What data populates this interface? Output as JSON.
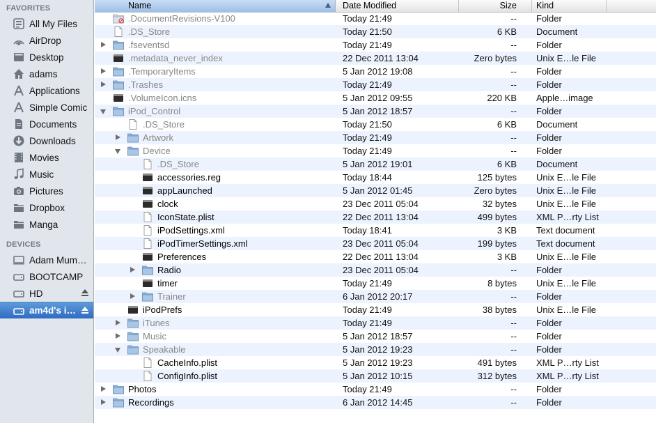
{
  "sidebar": {
    "favorites_header": "FAVORITES",
    "devices_header": "DEVICES",
    "favorites": [
      {
        "label": "All My Files",
        "icon": "all-files-icon"
      },
      {
        "label": "AirDrop",
        "icon": "airdrop-icon"
      },
      {
        "label": "Desktop",
        "icon": "desktop-icon"
      },
      {
        "label": "adams",
        "icon": "home-icon"
      },
      {
        "label": "Applications",
        "icon": "applications-icon"
      },
      {
        "label": "Simple Comic",
        "icon": "applications-icon"
      },
      {
        "label": "Documents",
        "icon": "documents-icon"
      },
      {
        "label": "Downloads",
        "icon": "downloads-icon"
      },
      {
        "label": "Movies",
        "icon": "movies-icon"
      },
      {
        "label": "Music",
        "icon": "music-icon"
      },
      {
        "label": "Pictures",
        "icon": "pictures-icon"
      },
      {
        "label": "Dropbox",
        "icon": "folder-icon"
      },
      {
        "label": "Manga",
        "icon": "folder-icon"
      }
    ],
    "devices": [
      {
        "label": "Adam Mum…",
        "icon": "computer-icon",
        "eject": false,
        "selected": false
      },
      {
        "label": "BOOTCAMP",
        "icon": "drive-icon",
        "eject": false,
        "selected": false
      },
      {
        "label": "HD",
        "icon": "drive-icon",
        "eject": true,
        "selected": false
      },
      {
        "label": "am4d's i…",
        "icon": "ipod-drive-icon",
        "eject": true,
        "selected": true
      }
    ]
  },
  "columns": {
    "name": "Name",
    "date": "Date Modified",
    "size": "Size",
    "kind": "Kind"
  },
  "files": [
    {
      "name": ".DocumentRevisions-V100",
      "date": "Today 21:49",
      "size": "--",
      "kind": "Folder",
      "indent": 0,
      "disclosure": "none",
      "icon": "restricted-folder",
      "dim": true
    },
    {
      "name": ".DS_Store",
      "date": "Today 21:50",
      "size": "6 KB",
      "kind": "Document",
      "indent": 0,
      "disclosure": "none",
      "icon": "document",
      "dim": true
    },
    {
      "name": ".fseventsd",
      "date": "Today 21:49",
      "size": "--",
      "kind": "Folder",
      "indent": 0,
      "disclosure": "closed",
      "icon": "folder",
      "dim": true
    },
    {
      "name": ".metadata_never_index",
      "date": "22 Dec 2011 13:04",
      "size": "Zero bytes",
      "kind": "Unix E…le File",
      "indent": 0,
      "disclosure": "none",
      "icon": "exec",
      "dim": true
    },
    {
      "name": ".TemporaryItems",
      "date": "5 Jan 2012 19:08",
      "size": "--",
      "kind": "Folder",
      "indent": 0,
      "disclosure": "closed",
      "icon": "folder",
      "dim": true
    },
    {
      "name": ".Trashes",
      "date": "Today 21:49",
      "size": "--",
      "kind": "Folder",
      "indent": 0,
      "disclosure": "closed",
      "icon": "folder",
      "dim": true
    },
    {
      "name": ".VolumeIcon.icns",
      "date": "5 Jan 2012 09:55",
      "size": "220 KB",
      "kind": "Apple…image",
      "indent": 0,
      "disclosure": "none",
      "icon": "exec",
      "dim": true
    },
    {
      "name": "iPod_Control",
      "date": "5 Jan 2012 18:57",
      "size": "--",
      "kind": "Folder",
      "indent": 0,
      "disclosure": "open",
      "icon": "folder",
      "dim": true
    },
    {
      "name": ".DS_Store",
      "date": "Today 21:50",
      "size": "6 KB",
      "kind": "Document",
      "indent": 1,
      "disclosure": "none",
      "icon": "document",
      "dim": true
    },
    {
      "name": "Artwork",
      "date": "Today 21:49",
      "size": "--",
      "kind": "Folder",
      "indent": 1,
      "disclosure": "closed",
      "icon": "folder",
      "dim": true
    },
    {
      "name": "Device",
      "date": "Today 21:49",
      "size": "--",
      "kind": "Folder",
      "indent": 1,
      "disclosure": "open",
      "icon": "folder",
      "dim": true
    },
    {
      "name": ".DS_Store",
      "date": "5 Jan 2012 19:01",
      "size": "6 KB",
      "kind": "Document",
      "indent": 2,
      "disclosure": "none",
      "icon": "document",
      "dim": true
    },
    {
      "name": "accessories.reg",
      "date": "Today 18:44",
      "size": "125 bytes",
      "kind": "Unix E…le File",
      "indent": 2,
      "disclosure": "none",
      "icon": "exec",
      "dim": false
    },
    {
      "name": "appLaunched",
      "date": "5 Jan 2012 01:45",
      "size": "Zero bytes",
      "kind": "Unix E…le File",
      "indent": 2,
      "disclosure": "none",
      "icon": "exec",
      "dim": false
    },
    {
      "name": "clock",
      "date": "23 Dec 2011 05:04",
      "size": "32 bytes",
      "kind": "Unix E…le File",
      "indent": 2,
      "disclosure": "none",
      "icon": "exec",
      "dim": false
    },
    {
      "name": "IconState.plist",
      "date": "22 Dec 2011 13:04",
      "size": "499 bytes",
      "kind": "XML P…rty List",
      "indent": 2,
      "disclosure": "none",
      "icon": "document",
      "dim": false
    },
    {
      "name": "iPodSettings.xml",
      "date": "Today 18:41",
      "size": "3 KB",
      "kind": "Text document",
      "indent": 2,
      "disclosure": "none",
      "icon": "document",
      "dim": false
    },
    {
      "name": "iPodTimerSettings.xml",
      "date": "23 Dec 2011 05:04",
      "size": "199 bytes",
      "kind": "Text document",
      "indent": 2,
      "disclosure": "none",
      "icon": "document",
      "dim": false
    },
    {
      "name": "Preferences",
      "date": "22 Dec 2011 13:04",
      "size": "3 KB",
      "kind": "Unix E…le File",
      "indent": 2,
      "disclosure": "none",
      "icon": "exec",
      "dim": false
    },
    {
      "name": "Radio",
      "date": "23 Dec 2011 05:04",
      "size": "--",
      "kind": "Folder",
      "indent": 2,
      "disclosure": "closed",
      "icon": "folder",
      "dim": false
    },
    {
      "name": "timer",
      "date": "Today 21:49",
      "size": "8 bytes",
      "kind": "Unix E…le File",
      "indent": 2,
      "disclosure": "none",
      "icon": "exec",
      "dim": false
    },
    {
      "name": "Trainer",
      "date": "6 Jan 2012 20:17",
      "size": "--",
      "kind": "Folder",
      "indent": 2,
      "disclosure": "closed",
      "icon": "folder",
      "dim": true
    },
    {
      "name": "iPodPrefs",
      "date": "Today 21:49",
      "size": "38 bytes",
      "kind": "Unix E…le File",
      "indent": 1,
      "disclosure": "none",
      "icon": "exec",
      "dim": false
    },
    {
      "name": "iTunes",
      "date": "Today 21:49",
      "size": "--",
      "kind": "Folder",
      "indent": 1,
      "disclosure": "closed",
      "icon": "folder",
      "dim": true
    },
    {
      "name": "Music",
      "date": "5 Jan 2012 18:57",
      "size": "--",
      "kind": "Folder",
      "indent": 1,
      "disclosure": "closed",
      "icon": "folder",
      "dim": true
    },
    {
      "name": "Speakable",
      "date": "5 Jan 2012 19:23",
      "size": "--",
      "kind": "Folder",
      "indent": 1,
      "disclosure": "open",
      "icon": "folder",
      "dim": true
    },
    {
      "name": "CacheInfo.plist",
      "date": "5 Jan 2012 19:23",
      "size": "491 bytes",
      "kind": "XML P…rty List",
      "indent": 2,
      "disclosure": "none",
      "icon": "document",
      "dim": false
    },
    {
      "name": "ConfigInfo.plist",
      "date": "5 Jan 2012 10:15",
      "size": "312 bytes",
      "kind": "XML P…rty List",
      "indent": 2,
      "disclosure": "none",
      "icon": "document",
      "dim": false
    },
    {
      "name": "Photos",
      "date": "Today 21:49",
      "size": "--",
      "kind": "Folder",
      "indent": 0,
      "disclosure": "closed",
      "icon": "folder",
      "dim": false
    },
    {
      "name": "Recordings",
      "date": "6 Jan 2012 14:45",
      "size": "--",
      "kind": "Folder",
      "indent": 0,
      "disclosure": "closed",
      "icon": "folder",
      "dim": false
    }
  ]
}
